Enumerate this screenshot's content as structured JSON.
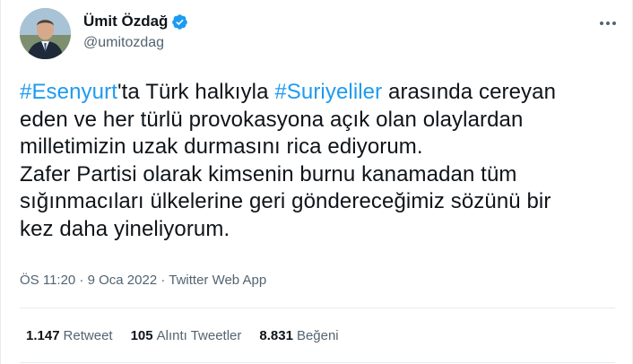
{
  "author": {
    "display_name": "Ümit Özdağ",
    "handle": "@umitozdag",
    "verified": true
  },
  "tweet": {
    "lines": [
      [
        {
          "text": "#Esenyurt",
          "type": "hashtag"
        },
        {
          "text": "'ta Türk halkıyla ",
          "type": "text"
        },
        {
          "text": "#Suriyeliler",
          "type": "hashtag"
        },
        {
          "text": " arasında cereyan",
          "type": "text"
        }
      ],
      [
        {
          "text": "eden ve her türlü provokasyona açık olan olaylardan",
          "type": "text"
        }
      ],
      [
        {
          "text": "milletimizin uzak durmasını rica ediyorum.",
          "type": "text"
        }
      ],
      [
        {
          "text": "Zafer Partisi olarak kimsenin burnu kanamadan tüm",
          "type": "text"
        }
      ],
      [
        {
          "text": "sığınmacıları ülkelerine geri göndereceğimiz sözünü bir",
          "type": "text"
        }
      ],
      [
        {
          "text": "kez daha yineliyorum.",
          "type": "text"
        }
      ]
    ]
  },
  "meta": {
    "time": "ÖS 11:20",
    "separator1": " · ",
    "date": "9 Oca 2022",
    "separator2": " · ",
    "app": "Twitter Web App"
  },
  "stats": {
    "retweets": {
      "count": "1.147",
      "label": "Retweet"
    },
    "quotes": {
      "count": "105",
      "label": "Alıntı Tweetler"
    },
    "likes": {
      "count": "8.831",
      "label": "Beğeni"
    }
  },
  "icons": {
    "verified_badge": "verified-badge-icon",
    "more": "more-options-icon"
  },
  "colors": {
    "accent": "#1d9bf0",
    "text": "#0f1419",
    "secondary": "#536471"
  }
}
